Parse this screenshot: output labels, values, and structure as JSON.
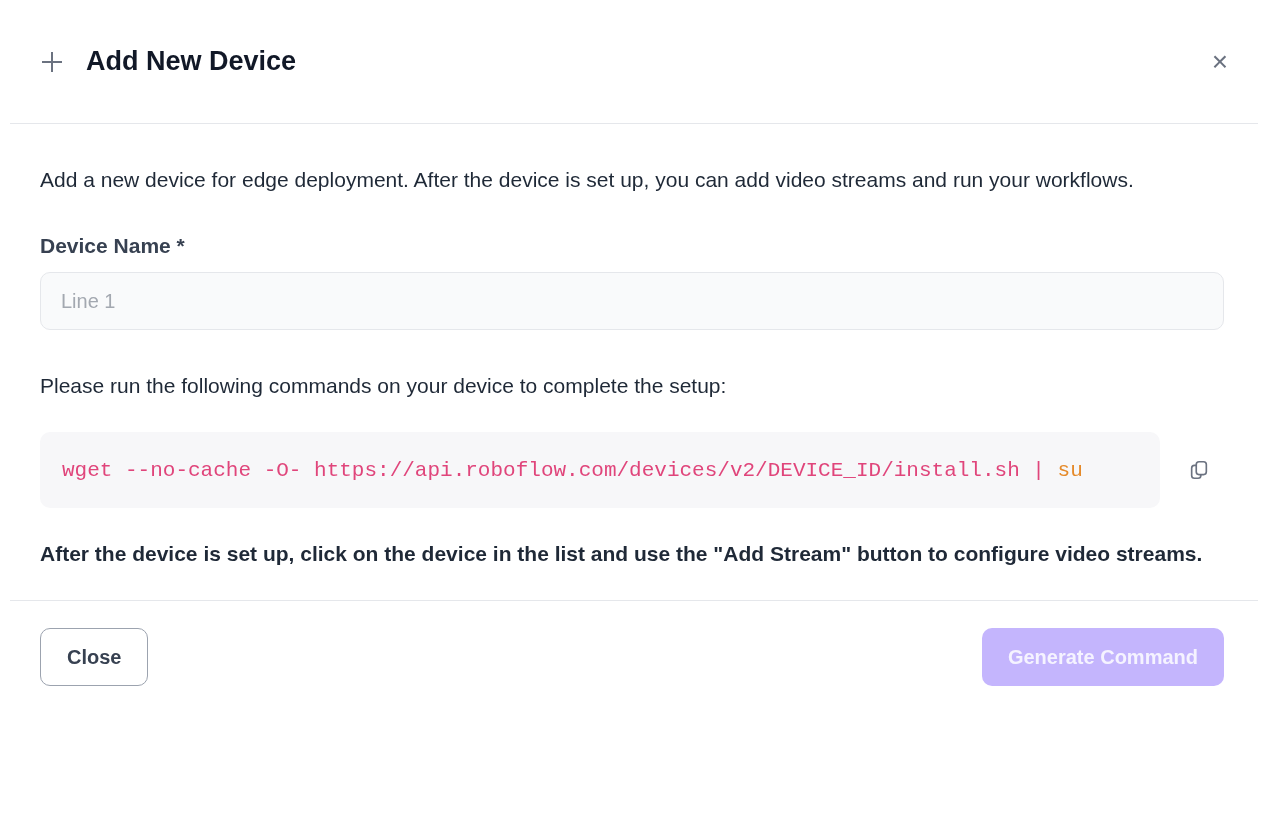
{
  "dialog": {
    "title": "Add New Device",
    "close_symbol": "×",
    "description": "Add a new device for edge deployment. After the device is set up, you can add video streams and run your workflows.",
    "field": {
      "label": "Device Name *",
      "placeholder": "Line 1"
    },
    "instructions": "Please run the following commands on your device to complete the setup:",
    "command": [
      {
        "kind": "main",
        "text": "wget --no-cache -O- https://api.roboflow.com/devices/v2/DEVICE_ID/install.sh |"
      },
      {
        "kind": "keyword",
        "text": "su"
      }
    ],
    "note": "After the device is set up, click on the device in the list and use the \"Add Stream\" button to configure video streams.",
    "buttons": [
      {
        "kind": "secondary",
        "label": "Close",
        "disabled": false
      },
      {
        "kind": "primary",
        "label": "Generate Command",
        "disabled": true
      }
    ]
  }
}
